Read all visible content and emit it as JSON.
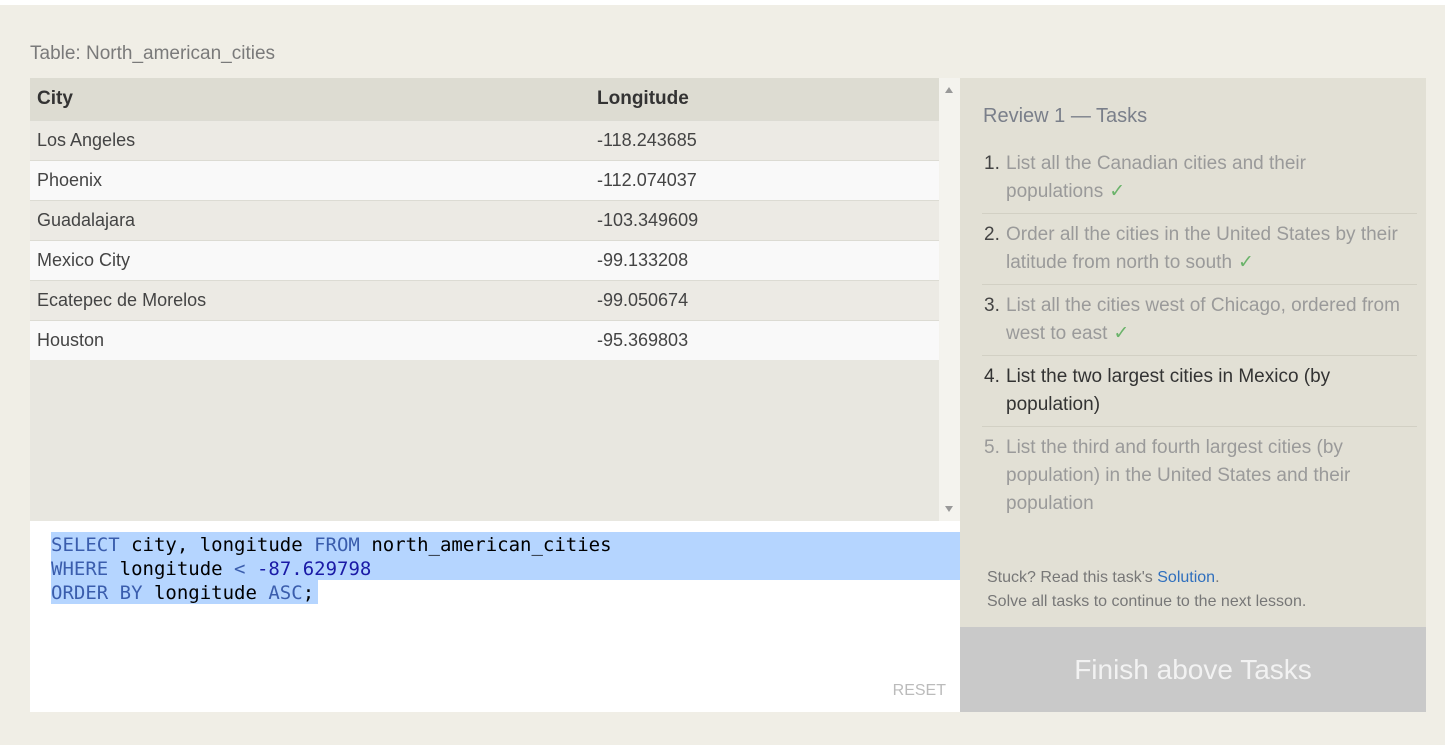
{
  "table": {
    "title": "Table: North_american_cities",
    "columns": [
      "City",
      "Longitude"
    ],
    "rows": [
      [
        "Los Angeles",
        "-118.243685"
      ],
      [
        "Phoenix",
        "-112.074037"
      ],
      [
        "Guadalajara",
        "-103.349609"
      ],
      [
        "Mexico City",
        "-99.133208"
      ],
      [
        "Ecatepec de Morelos",
        "-99.050674"
      ],
      [
        "Houston",
        "-95.369803"
      ]
    ]
  },
  "editor": {
    "line1": {
      "kw1": "SELECT",
      "t1": " city, longitude ",
      "kw2": "FROM",
      "t2": " north_american_cities"
    },
    "line2": {
      "kw1": "WHERE",
      "t1": " longitude ",
      "op": "<",
      "num": " -87.629798"
    },
    "line3": {
      "kw1": "ORDER BY",
      "t1": " longitude ",
      "kw2": "ASC",
      "t2": ";"
    },
    "reset_label": "RESET"
  },
  "tasks": {
    "title": "Review 1 — Tasks",
    "items": [
      {
        "num": "1.",
        "text": "List all the Canadian cities and their populations",
        "status": "done"
      },
      {
        "num": "2.",
        "text": "Order all the cities in the United States by their latitude from north to south",
        "status": "done"
      },
      {
        "num": "3.",
        "text": "List all the cities west of Chicago, ordered from west to east",
        "status": "done"
      },
      {
        "num": "4.",
        "text": "List the two largest cities in Mexico (by population)",
        "status": "current"
      },
      {
        "num": "5.",
        "text": "List the third and fourth largest cities (by population) in the United States and their population",
        "status": "pending"
      }
    ],
    "check_mark": "✓",
    "help_prefix": "Stuck? Read this task's ",
    "help_link": "Solution",
    "help_suffix": ".",
    "help_line2": "Solve all tasks to continue to the next lesson.",
    "finish_label": "Finish above Tasks"
  },
  "colors": {
    "selection": "#b5d5ff",
    "keyword": "#3a5dad",
    "check": "#6ab36a",
    "link": "#2f6fbd"
  }
}
